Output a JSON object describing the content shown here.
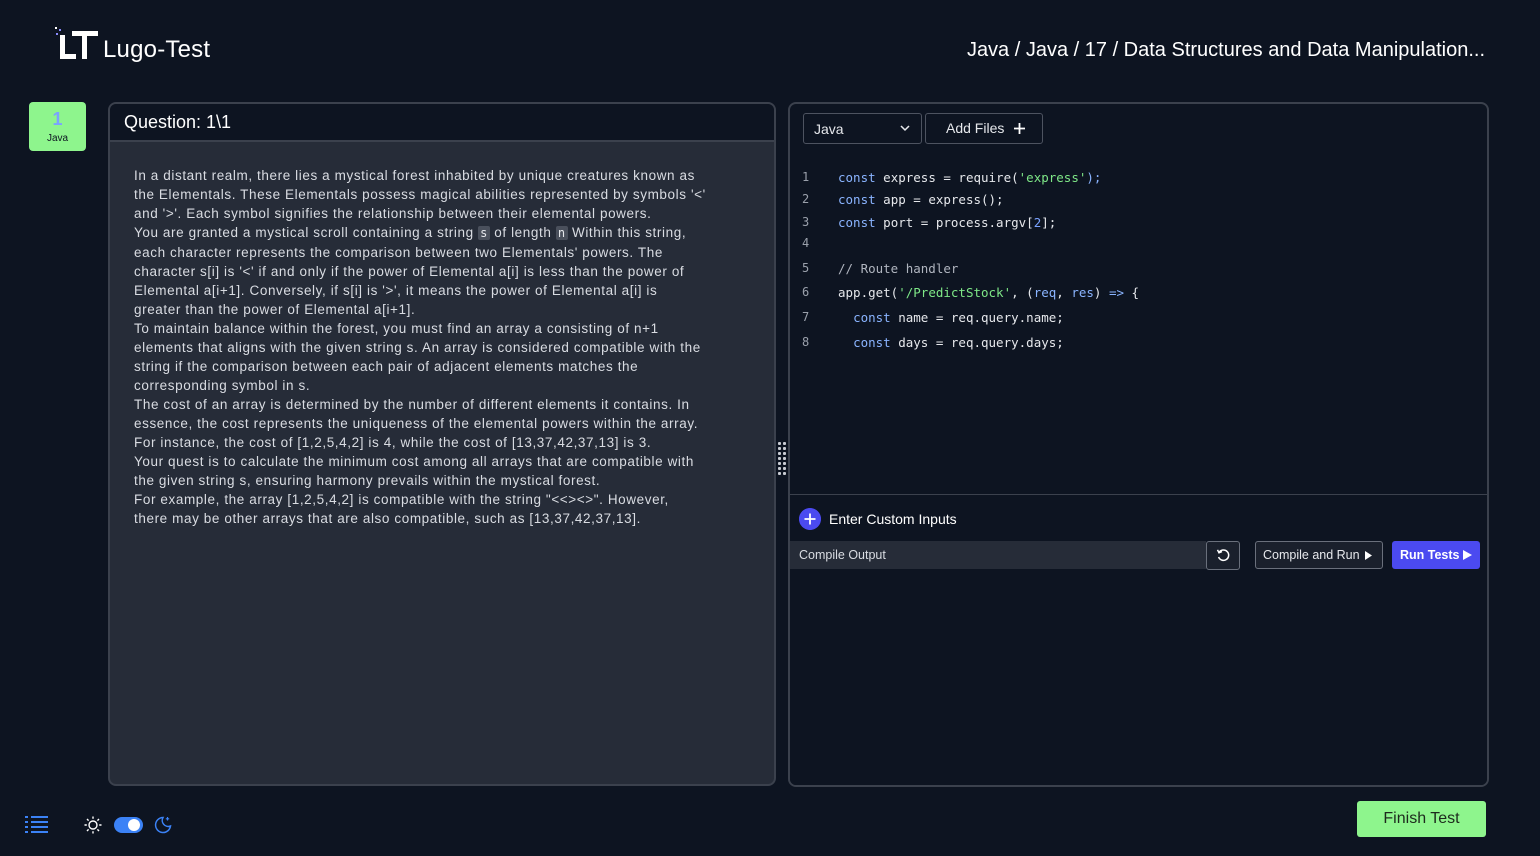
{
  "header": {
    "app_title": "Lugo-Test",
    "breadcrumb": "Java / Java / 17 / Data Structures and Data Manipulation..."
  },
  "question_nav": {
    "number": "1",
    "language": "Java"
  },
  "question": {
    "title": "Question: 1\\1",
    "paragraphs": {
      "p1": "In a distant realm, there lies a mystical forest inhabited by unique creatures known as the Elementals. These Elementals possess magical abilities represented by symbols '<' and '>'. Each symbol signifies the relationship between their elemental powers.",
      "p2_before": "You are granted a mystical scroll containing a string ",
      "p2_chip1": "s",
      "p2_mid": " of length ",
      "p2_chip2": "n",
      "p2_after": " Within this string, each character represents the comparison between two Elementals' powers. The character s[i] is '<' if and only if the power of Elemental a[i] is less than the power of Elemental a[i+1]. Conversely, if s[i] is '>', it means the power of Elemental a[i] is greater than the power of Elemental a[i+1].",
      "p3": "To maintain balance within the forest, you must find an array a consisting of n+1 elements that aligns with the given string s. An array is considered compatible with the string if the comparison between each pair of adjacent elements matches the corresponding symbol in s.",
      "p4": "The cost of an array is determined by the number of different elements it contains. In essence, the cost represents the uniqueness of the elemental powers within the array. For instance, the cost of [1,2,5,4,2] is 4, while the cost of [13,37,42,37,13] is 3.",
      "p5": "Your quest is to calculate the minimum cost among all arrays that are compatible with the given string s, ensuring harmony prevails within the mystical forest.",
      "p6": "For example, the array [1,2,5,4,2] is compatible with the string \"<<><>\". However, there may be other arrays that are also compatible, such as [13,37,42,37,13]."
    }
  },
  "editor": {
    "language_selected": "Java",
    "add_files_label": "Add Files",
    "line_numbers": [
      "1",
      "2",
      "3",
      "4",
      "5",
      "6",
      "7",
      "8"
    ],
    "code": {
      "l1_kw": "const",
      "l1_rest": " express = require(",
      "l1_str": "'express'",
      "l1_end": ");",
      "l2_kw": "const",
      "l2_rest": " app = express();",
      "l3_kw": "const",
      "l3_rest": " port = process.argv[",
      "l3_num": "2",
      "l3_end": "];",
      "l5_comment": "// Route handler",
      "l6_a": "app.get(",
      "l6_str": "'/PredictStock'",
      "l6_b": ", (",
      "l6_p1": "req",
      "l6_c": ", ",
      "l6_p2": "res",
      "l6_d": ") ",
      "l6_arrow": "=>",
      "l6_e": " {",
      "l7_kw": "const",
      "l7_rest": " name = req.query.name;",
      "l8_kw": "const",
      "l8_rest": " days = req.query.days;"
    }
  },
  "custom_inputs_label": "Enter Custom Inputs",
  "compile": {
    "output_label": "Compile Output",
    "compile_run_label": "Compile and Run",
    "run_tests_label": "Run Tests"
  },
  "footer": {
    "finish_label": "Finish Test",
    "dark_mode_enabled": true
  },
  "colors": {
    "background": "#0d1421",
    "panel": "#262c38",
    "accent_green": "#8ef58d",
    "accent_blue": "#4b4af0",
    "toggle_blue": "#3b82f6"
  },
  "icons": [
    "logo-icon",
    "chevron-down-icon",
    "plus-icon",
    "add-circle-icon",
    "reset-icon",
    "play-icon",
    "list-icon",
    "sun-icon",
    "moon-icon",
    "drag-handle-icon"
  ]
}
